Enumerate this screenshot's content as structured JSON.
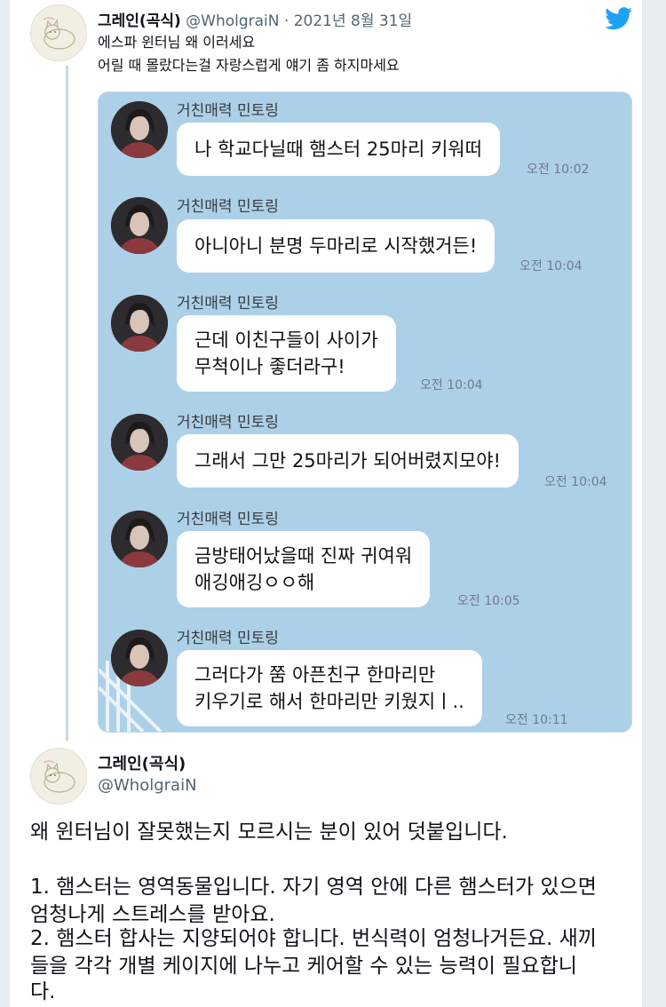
{
  "tweet1": {
    "name": "그레인(곡식)",
    "handle": "@WholgraiN",
    "date": "· 2021년 8월 31일",
    "lines": [
      "에스파 윈터님 왜 이러세요",
      "어릴 때 몰랐다는걸 자랑스럽게 얘기 좀 하지마세요"
    ],
    "icon": "twitter-bird-icon",
    "brand_color": "#1da1f2"
  },
  "chat": {
    "background": "#acd0e8",
    "messages": [
      {
        "sender": "거친매력 민토링",
        "lines": [
          "나 학교다닐때 햄스터 25마리 키워떠"
        ],
        "time": "오전 10:02"
      },
      {
        "sender": "거친매력 민토링",
        "lines": [
          "아니아니 분명 두마리로 시작했거든!"
        ],
        "time": "오전 10:04"
      },
      {
        "sender": "거친매력 민토링",
        "lines": [
          "근데 이친구들이 사이가",
          "무척이나 좋더라구!"
        ],
        "time": "오전 10:04"
      },
      {
        "sender": "거친매력 민토링",
        "lines": [
          "그래서 그만 25마리가 되어버렸지모야!"
        ],
        "time": "오전 10:04"
      },
      {
        "sender": "거친매력 민토링",
        "lines": [
          "금방태어났을때 진짜 귀여워",
          "애깅애깅ㅇㅇ해"
        ],
        "time": "오전 10:05"
      },
      {
        "sender": "거친매력 민토링",
        "lines": [
          "그러다가 쭘 아픈친구 한마리만",
          "키우기로 해서 한마리만 키웠지ㅣ.."
        ],
        "time": "오전 10:11"
      }
    ]
  },
  "tweet2": {
    "name": "그레인(곡식)",
    "handle": "@WholgraiN",
    "lines": [
      "왜 윈터님이 잘못했는지 모르시는 분이 있어 덧붙입니다.",
      "",
      "1. 햄스터는 영역동물입니다. 자기 영역 안에 다른 햄스터가 있으면",
      "엄청나게 스트레스를 받아요.",
      "2. 햄스터 합사는 지양되어야 합니다. 번식력이 엄청나거든요. 새끼",
      "들을 각각 개별 케이지에 나누고 케어할 수 있는 능력이 필요합니",
      "다."
    ]
  }
}
